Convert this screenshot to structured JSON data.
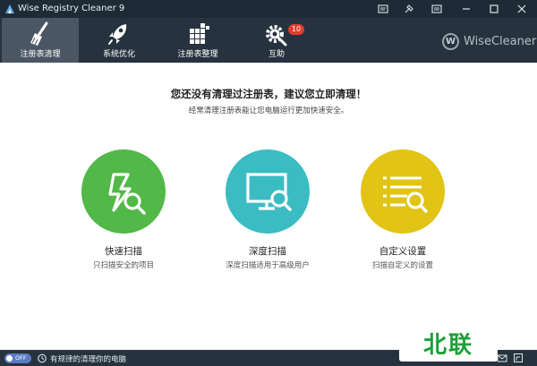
{
  "window": {
    "title": "Wise Registry Cleaner 9",
    "controls": [
      "message-icon",
      "theme-icon",
      "menu-icon",
      "minimize-icon",
      "maximize-icon",
      "close-icon"
    ]
  },
  "toolbar": {
    "tabs": [
      {
        "label": "注册表清理",
        "icon": "broom-icon",
        "active": true
      },
      {
        "label": "系统优化",
        "icon": "rocket-icon",
        "active": false
      },
      {
        "label": "注册表整理",
        "icon": "blocks-icon",
        "active": false
      },
      {
        "label": "互助",
        "icon": "gear-wrench-icon",
        "active": false,
        "badge": "10"
      }
    ],
    "brand": {
      "logo_letter": "W",
      "name": "WiseCleaner"
    }
  },
  "main": {
    "headline": "您还没有清理过注册表，建议您立即清理！",
    "subline": "经常清理注册表能让您电脑运行更加快速安全。",
    "scans": [
      {
        "title": "快速扫描",
        "desc": "只扫描安全的项目",
        "icon": "lightning-search-icon",
        "color": "#52b848"
      },
      {
        "title": "深度扫描",
        "desc": "深度扫描适用于高级用户",
        "icon": "monitor-search-icon",
        "color": "#3bbcc3"
      },
      {
        "title": "自定义设置",
        "desc": "扫描自定义的设置",
        "icon": "list-search-icon",
        "color": "#e1c415"
      }
    ]
  },
  "statusbar": {
    "toggle_label": "OFF",
    "text": "有规律的清理你的电脑"
  },
  "watermark": "北联",
  "colors": {
    "titlebar": "#1e2b36",
    "toolbar": "#26323e",
    "active_tab": "#4a5663",
    "badge": "#e23b2e"
  }
}
